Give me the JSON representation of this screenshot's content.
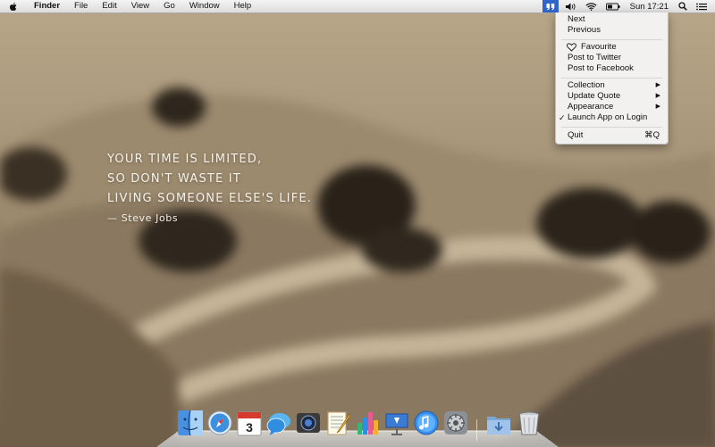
{
  "menubar": {
    "app_name": "Finder",
    "menus": [
      "File",
      "Edit",
      "View",
      "Go",
      "Window",
      "Help"
    ],
    "clock": "Sun 17:21"
  },
  "quote": {
    "lines": [
      "YOUR TIME IS LIMITED,",
      "SO DON'T WASTE IT",
      "LIVING SOMEONE ELSE'S LIFE."
    ],
    "author": "— Steve Jobs"
  },
  "dropdown": {
    "next": "Next",
    "previous": "Previous",
    "favourite": "Favourite",
    "post_twitter": "Post to Twitter",
    "post_facebook": "Post to Facebook",
    "collection": "Collection",
    "update_quote": "Update Quote",
    "appearance": "Appearance",
    "launch_on_login": "Launch App on Login",
    "quit": "Quit",
    "quit_shortcut": "⌘Q",
    "submenu_arrow": "▶",
    "checkmark": "✓"
  },
  "dock": {
    "calendar_day": "3",
    "apps": [
      "finder-icon",
      "safari-icon",
      "calendar-icon",
      "messages-icon",
      "facetime-icon",
      "textedit-icon",
      "numbers-icon",
      "keynote-icon",
      "itunes-icon",
      "system-preferences-icon",
      "downloads-folder-icon",
      "trash-icon"
    ]
  },
  "colors": {
    "menu_highlight": "#2f64c8",
    "quote_text": "#f6f2ea"
  }
}
